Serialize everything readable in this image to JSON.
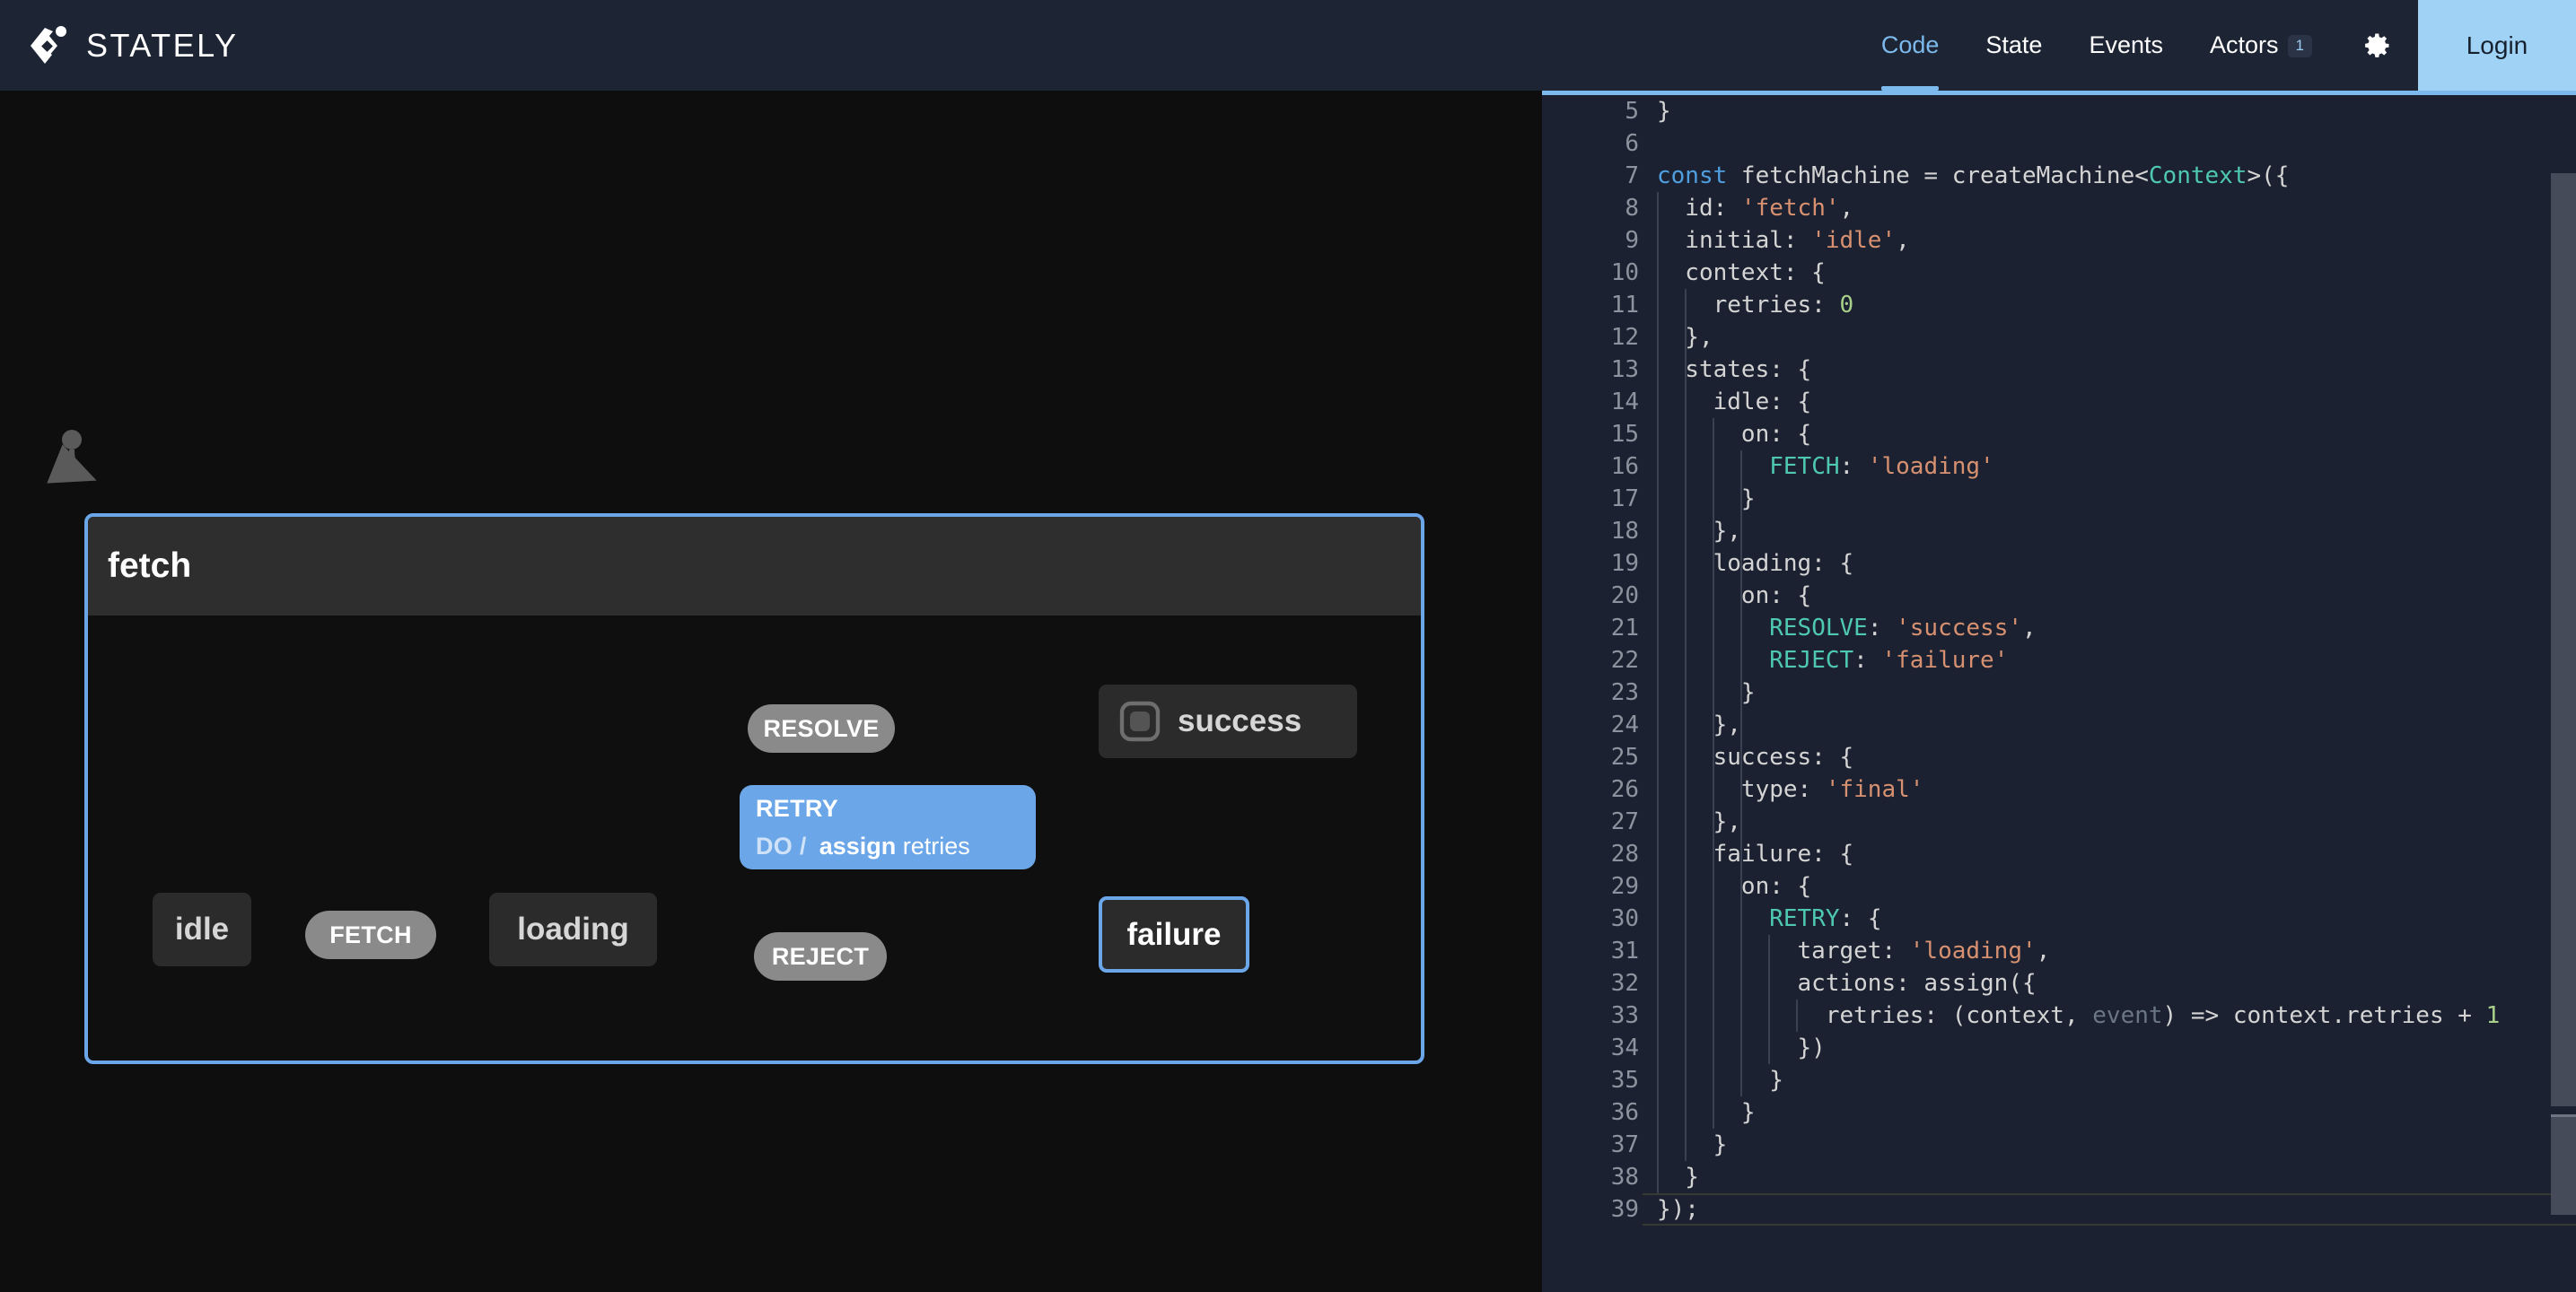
{
  "header": {
    "brand": "STATELY",
    "brand_logo_icon": "stately-diamond-logo",
    "tabs": [
      {
        "label": "Code",
        "active": true,
        "badge": null
      },
      {
        "label": "State",
        "active": false,
        "badge": null
      },
      {
        "label": "Events",
        "active": false,
        "badge": null
      },
      {
        "label": "Actors",
        "active": false,
        "badge": "1"
      }
    ],
    "settings_icon": "gear-icon",
    "login_label": "Login",
    "accent_color": "#7cb9ec",
    "login_bg": "#9fd2f5",
    "bg": "#1d2433"
  },
  "canvas": {
    "machine_title": "fetch",
    "machine_border_color": "#6aa6e8",
    "nodes": [
      {
        "id": "idle",
        "label": "idle",
        "active": false
      },
      {
        "id": "loading",
        "label": "loading",
        "active": false
      },
      {
        "id": "success",
        "label": "success",
        "active": false,
        "final": true
      },
      {
        "id": "failure",
        "label": "failure",
        "active": true
      }
    ],
    "events": [
      {
        "id": "fetch",
        "label": "FETCH",
        "from": "idle",
        "to": "loading",
        "highlighted": false
      },
      {
        "id": "resolve",
        "label": "RESOLVE",
        "from": "loading",
        "to": "success",
        "highlighted": false
      },
      {
        "id": "reject",
        "label": "REJECT",
        "from": "loading",
        "to": "failure",
        "highlighted": false
      }
    ],
    "retry_transition": {
      "label": "RETRY",
      "do_label": "DO /",
      "action_name": "assign",
      "action_arg": "retries",
      "from": "failure",
      "to": "loading",
      "highlighted": true,
      "color": "#6aa6e8"
    }
  },
  "editor": {
    "lines": [
      {
        "n": "5",
        "current": false,
        "guides": 0,
        "tokens": [
          {
            "t": "}",
            "c": "t-punc"
          }
        ]
      },
      {
        "n": "6",
        "current": false,
        "guides": 0,
        "tokens": []
      },
      {
        "n": "7",
        "current": false,
        "guides": 0,
        "tokens": [
          {
            "t": "const",
            "c": "t-kw"
          },
          {
            "t": " fetchMachine = createMachine<",
            "c": "t-id"
          },
          {
            "t": "Context",
            "c": "t-type"
          },
          {
            "t": ">({",
            "c": "t-id"
          }
        ]
      },
      {
        "n": "8",
        "current": false,
        "guides": 1,
        "tokens": [
          {
            "t": "  id: ",
            "c": "t-id"
          },
          {
            "t": "'fetch'",
            "c": "t-str"
          },
          {
            "t": ",",
            "c": "t-punc"
          }
        ]
      },
      {
        "n": "9",
        "current": false,
        "guides": 1,
        "tokens": [
          {
            "t": "  initial: ",
            "c": "t-id"
          },
          {
            "t": "'idle'",
            "c": "t-str"
          },
          {
            "t": ",",
            "c": "t-punc"
          }
        ]
      },
      {
        "n": "10",
        "current": false,
        "guides": 1,
        "tokens": [
          {
            "t": "  context: {",
            "c": "t-id"
          }
        ]
      },
      {
        "n": "11",
        "current": false,
        "guides": 2,
        "tokens": [
          {
            "t": "    retries: ",
            "c": "t-id"
          },
          {
            "t": "0",
            "c": "t-num"
          }
        ]
      },
      {
        "n": "12",
        "current": false,
        "guides": 1,
        "tokens": [
          {
            "t": "  },",
            "c": "t-punc"
          }
        ]
      },
      {
        "n": "13",
        "current": false,
        "guides": 1,
        "tokens": [
          {
            "t": "  states: {",
            "c": "t-id"
          }
        ]
      },
      {
        "n": "14",
        "current": false,
        "guides": 2,
        "tokens": [
          {
            "t": "    idle: {",
            "c": "t-id"
          }
        ]
      },
      {
        "n": "15",
        "current": false,
        "guides": 3,
        "tokens": [
          {
            "t": "      on: {",
            "c": "t-id"
          }
        ]
      },
      {
        "n": "16",
        "current": false,
        "guides": 4,
        "tokens": [
          {
            "t": "        ",
            "c": "t-id"
          },
          {
            "t": "FETCH",
            "c": "t-ev"
          },
          {
            "t": ": ",
            "c": "t-punc"
          },
          {
            "t": "'loading'",
            "c": "t-str"
          }
        ]
      },
      {
        "n": "17",
        "current": false,
        "guides": 3,
        "tokens": [
          {
            "t": "      }",
            "c": "t-punc"
          }
        ]
      },
      {
        "n": "18",
        "current": false,
        "guides": 2,
        "tokens": [
          {
            "t": "    },",
            "c": "t-punc"
          }
        ]
      },
      {
        "n": "19",
        "current": false,
        "guides": 2,
        "tokens": [
          {
            "t": "    loading: {",
            "c": "t-id"
          }
        ]
      },
      {
        "n": "20",
        "current": false,
        "guides": 3,
        "tokens": [
          {
            "t": "      on: {",
            "c": "t-id"
          }
        ]
      },
      {
        "n": "21",
        "current": false,
        "guides": 4,
        "tokens": [
          {
            "t": "        ",
            "c": "t-id"
          },
          {
            "t": "RESOLVE",
            "c": "t-ev"
          },
          {
            "t": ": ",
            "c": "t-punc"
          },
          {
            "t": "'success'",
            "c": "t-str"
          },
          {
            "t": ",",
            "c": "t-punc"
          }
        ]
      },
      {
        "n": "22",
        "current": false,
        "guides": 4,
        "tokens": [
          {
            "t": "        ",
            "c": "t-id"
          },
          {
            "t": "REJECT",
            "c": "t-ev"
          },
          {
            "t": ": ",
            "c": "t-punc"
          },
          {
            "t": "'failure'",
            "c": "t-str"
          }
        ]
      },
      {
        "n": "23",
        "current": false,
        "guides": 3,
        "tokens": [
          {
            "t": "      }",
            "c": "t-punc"
          }
        ]
      },
      {
        "n": "24",
        "current": false,
        "guides": 2,
        "tokens": [
          {
            "t": "    },",
            "c": "t-punc"
          }
        ]
      },
      {
        "n": "25",
        "current": false,
        "guides": 2,
        "tokens": [
          {
            "t": "    success: {",
            "c": "t-id"
          }
        ]
      },
      {
        "n": "26",
        "current": false,
        "guides": 3,
        "tokens": [
          {
            "t": "      type: ",
            "c": "t-id"
          },
          {
            "t": "'final'",
            "c": "t-str"
          }
        ]
      },
      {
        "n": "27",
        "current": false,
        "guides": 2,
        "tokens": [
          {
            "t": "    },",
            "c": "t-punc"
          }
        ]
      },
      {
        "n": "28",
        "current": false,
        "guides": 2,
        "tokens": [
          {
            "t": "    failure: {",
            "c": "t-id"
          }
        ]
      },
      {
        "n": "29",
        "current": false,
        "guides": 3,
        "tokens": [
          {
            "t": "      on: {",
            "c": "t-id"
          }
        ]
      },
      {
        "n": "30",
        "current": false,
        "guides": 4,
        "tokens": [
          {
            "t": "        ",
            "c": "t-id"
          },
          {
            "t": "RETRY",
            "c": "t-ev"
          },
          {
            "t": ": {",
            "c": "t-punc"
          }
        ]
      },
      {
        "n": "31",
        "current": false,
        "guides": 5,
        "tokens": [
          {
            "t": "          target: ",
            "c": "t-id"
          },
          {
            "t": "'loading'",
            "c": "t-str"
          },
          {
            "t": ",",
            "c": "t-punc"
          }
        ]
      },
      {
        "n": "32",
        "current": false,
        "guides": 5,
        "tokens": [
          {
            "t": "          actions: assign({",
            "c": "t-id"
          }
        ]
      },
      {
        "n": "33",
        "current": false,
        "guides": 6,
        "tokens": [
          {
            "t": "            retries: (context, ",
            "c": "t-id"
          },
          {
            "t": "event",
            "c": "t-dim"
          },
          {
            "t": ") => context.retries + ",
            "c": "t-id"
          },
          {
            "t": "1",
            "c": "t-num"
          }
        ]
      },
      {
        "n": "34",
        "current": false,
        "guides": 5,
        "tokens": [
          {
            "t": "          })",
            "c": "t-punc"
          }
        ]
      },
      {
        "n": "35",
        "current": false,
        "guides": 4,
        "tokens": [
          {
            "t": "        }",
            "c": "t-punc"
          }
        ]
      },
      {
        "n": "36",
        "current": false,
        "guides": 3,
        "tokens": [
          {
            "t": "      }",
            "c": "t-punc"
          }
        ]
      },
      {
        "n": "37",
        "current": false,
        "guides": 2,
        "tokens": [
          {
            "t": "    }",
            "c": "t-punc"
          }
        ]
      },
      {
        "n": "38",
        "current": false,
        "guides": 1,
        "tokens": [
          {
            "t": "  }",
            "c": "t-punc"
          }
        ]
      },
      {
        "n": "39",
        "current": true,
        "guides": 0,
        "tokens": [
          {
            "t": "});",
            "c": "t-punc"
          }
        ]
      }
    ],
    "vscrollbar": "vertical-scrollbar",
    "hscrollbar": "horizontal-scrollbar"
  }
}
